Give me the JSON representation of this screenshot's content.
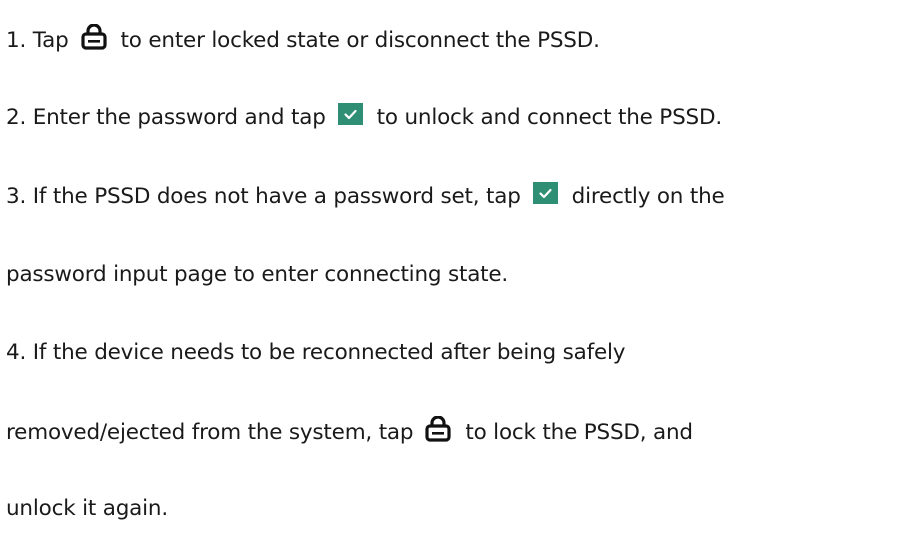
{
  "steps": [
    {
      "before": "1. Tap",
      "icon": "lock-icon",
      "after": "to enter locked state or disconnect the PSSD."
    },
    {
      "before": "2. Enter the password and tap",
      "icon": "check-icon",
      "after": "to unlock and connect the PSSD."
    },
    {
      "before": "3. If the PSSD does not have a password set, tap",
      "icon": "check-icon",
      "after": "directly on the",
      "continuation": "password input page to enter connecting state."
    },
    {
      "line1": "4. If the device needs to be reconnected after being safely",
      "before": "removed/ejected from the system, tap",
      "icon": "lock-icon",
      "after": "to lock the PSSD, and",
      "continuation": "unlock it again."
    }
  ],
  "colors": {
    "text": "#1a1a1a",
    "check_badge": "#2f8f74",
    "lock_icon": "#111111"
  }
}
